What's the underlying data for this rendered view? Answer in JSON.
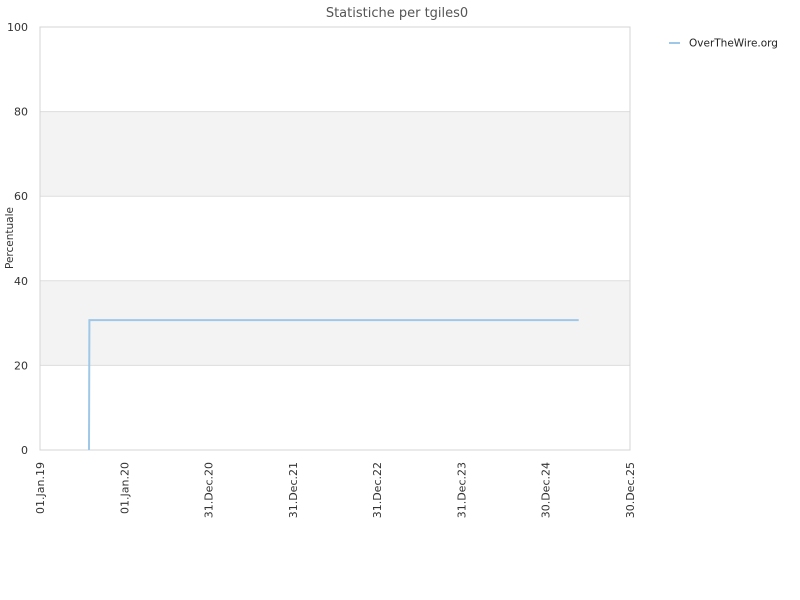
{
  "chart_data": {
    "type": "line",
    "title": "Statistiche per tgiles0",
    "xlabel": "",
    "ylabel": "Percentuale",
    "x_axis": {
      "type": "date",
      "range": [
        "2019-01-01",
        "2025-12-30"
      ],
      "tick_labels": [
        "01.Jan.19",
        "01.Jan.20",
        "31.Dec.20",
        "31.Dec.21",
        "31.Dec.22",
        "31.Dec.23",
        "30.Dec.24",
        "30.Dec.25"
      ],
      "tick_dates": [
        "2019-01-01",
        "2020-01-01",
        "2020-12-31",
        "2021-12-31",
        "2022-12-31",
        "2023-12-31",
        "2024-12-30",
        "2025-12-30"
      ],
      "label_rotation": "vertical"
    },
    "y_axis": {
      "range": [
        0,
        100
      ],
      "ticks": [
        0,
        20,
        40,
        60,
        80,
        100
      ]
    },
    "grid": true,
    "alternating_bands": true,
    "band_colors": [
      "#ffffff",
      "#f3f3f3"
    ],
    "legend": {
      "position": "top-right"
    },
    "series": [
      {
        "name": "OverTheWire.org",
        "color": "#9ec7e8",
        "points": [
          {
            "x": "2019-08-01",
            "y": 0
          },
          {
            "x": "2019-08-03",
            "y": 30.7
          },
          {
            "x": "2025-05-22",
            "y": 30.7
          }
        ]
      }
    ]
  }
}
